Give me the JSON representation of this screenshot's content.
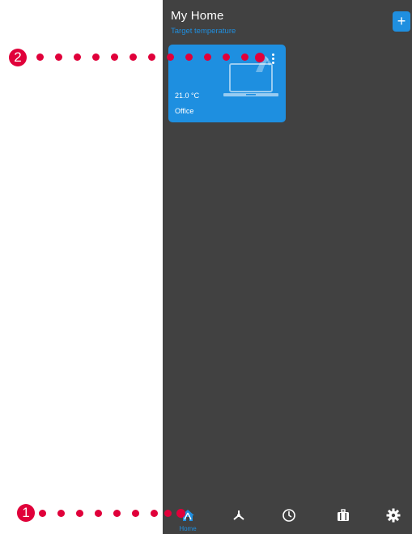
{
  "header": {
    "title": "My Home",
    "subtitle": "Target temperature",
    "add_label": "+"
  },
  "card": {
    "temperature": "21.0 °C",
    "room": "Office"
  },
  "nav": {
    "home_label": "Home"
  },
  "annotations": {
    "badge_1": "1",
    "badge_2": "2"
  },
  "colors": {
    "accent": "#1f8fe0",
    "panel": "#414141",
    "annotation": "#e0003a"
  }
}
